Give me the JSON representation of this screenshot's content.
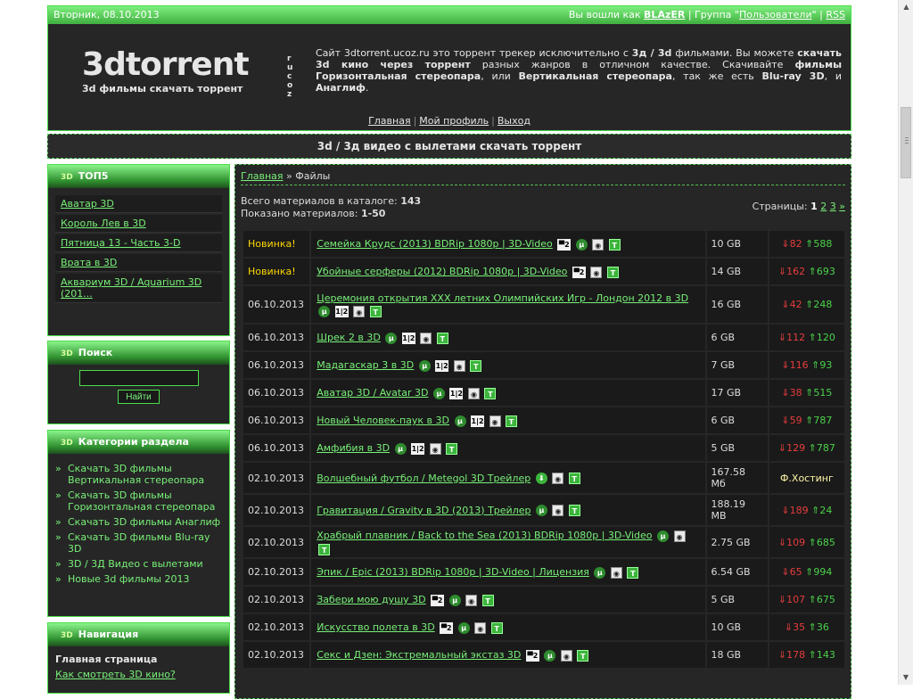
{
  "topbar": {
    "date": "Вторник, 08.10.2013",
    "logged_as": "Вы вошли как",
    "user": "BLAzER",
    "group_prefix": "| Группа \"",
    "group": "Пользователи",
    "group_suffix": "\" |",
    "rss": "RSS"
  },
  "logo": {
    "name": "3dtorrent",
    "domain": "ru\ncoz",
    "slogan": "3d фильмы скачать торрент"
  },
  "site_desc": {
    "p1": "Сайт 3dtorrent.ucoz.ru это торрент трекер исключительно с ",
    "b1": "3д / 3d",
    "p2": " фильмами. Вы можете ",
    "b2": "скачать 3d кино через торрент",
    "p3": " разных жанров в отличном качестве. Скачивайте ",
    "b3": "фильмы Горизонтальная стереопара",
    "p4": ", или ",
    "b4": "Вертикальная стереопара",
    "p5": ", так же есть ",
    "b5": "Blu-ray 3D",
    "p6": ", и ",
    "b6": "Анаглиф",
    "p7": "."
  },
  "header_nav": [
    "Главная",
    "Мой профиль",
    "Выход"
  ],
  "page_title": "3d / 3д видео с вылетами скачать торрент",
  "top5": {
    "title": "ТОП5",
    "items": [
      "Аватар 3D",
      "Король Лев в 3D",
      "Пятница 13 - Часть 3-D",
      "Врата в 3D",
      "Аквариум 3D / Aquarium 3D (201..."
    ]
  },
  "search": {
    "title": "Поиск",
    "value": "",
    "button": "Найти"
  },
  "categories": {
    "title": "Категории раздела",
    "items": [
      "Скачать 3D фильмы Вертикальная стереопара",
      "Скачать 3D фильмы Горизонтальная стереопара",
      "Скачать 3D фильмы Анаглиф",
      "Скачать 3D фильмы Blu-ray 3D",
      "3D / 3Д Видео с вылетами",
      "Новые 3d фильмы 2013"
    ]
  },
  "navigation": {
    "title": "Навигация",
    "home": "Главная страница",
    "link1": "Как смотреть 3D кино?"
  },
  "breadcrumb": {
    "home": "Главная",
    "sep": "»",
    "current": "Файлы"
  },
  "stats": {
    "total_label": "Всего материалов в каталоге:",
    "total": "143",
    "shown_label": "Показано материалов:",
    "shown": "1-50"
  },
  "pager": {
    "label": "Страницы:",
    "current": "1",
    "pages": [
      "2",
      "3",
      "»"
    ]
  },
  "files": [
    {
      "date": "Новинка!",
      "new": true,
      "title": "Семейка Крудс (2013) BDRip 1080p | 3D-Video",
      "icons": [
        "vs",
        "utor",
        "eye",
        "t"
      ],
      "size": "10 GB",
      "down": "82",
      "up": "588"
    },
    {
      "date": "Новинка!",
      "new": true,
      "title": "Убойные серферы (2012) BDRip 1080p | 3D-Video",
      "icons": [
        "vs",
        "eye",
        "t"
      ],
      "size": "14 GB",
      "down": "162",
      "up": "693"
    },
    {
      "date": "06.10.2013",
      "title": "Церемония открытия XXX летних Олимпийских Игр - Лондон 2012 в 3D",
      "icons": [
        "utor",
        "12",
        "eye",
        "t"
      ],
      "size": "16 GB",
      "down": "42",
      "up": "248"
    },
    {
      "date": "06.10.2013",
      "title": "Шрек 2 в 3D",
      "icons": [
        "utor",
        "12",
        "eye",
        "t"
      ],
      "size": "6 GB",
      "down": "112",
      "up": "120"
    },
    {
      "date": "06.10.2013",
      "title": "Мадагаскар 3 в 3D",
      "icons": [
        "utor",
        "12",
        "eye",
        "t"
      ],
      "size": "7 GB",
      "down": "116",
      "up": "93"
    },
    {
      "date": "06.10.2013",
      "title": "Аватар 3D / Avatar 3D",
      "icons": [
        "utor",
        "12",
        "eye",
        "t"
      ],
      "size": "17 GB",
      "down": "38",
      "up": "515"
    },
    {
      "date": "06.10.2013",
      "title": "Новый Человек-паук в 3D",
      "icons": [
        "utor",
        "12",
        "eye",
        "t"
      ],
      "size": "6 GB",
      "down": "59",
      "up": "787"
    },
    {
      "date": "06.10.2013",
      "title": "Амфибия в 3D",
      "icons": [
        "utor",
        "12",
        "eye",
        "t"
      ],
      "size": "5 GB",
      "down": "129",
      "up": "787"
    },
    {
      "date": "02.10.2013",
      "title": "Волшебный футбол / Metegol 3D Трейлер",
      "icons": [
        "down",
        "eye",
        "t"
      ],
      "size": "167.58 Мб",
      "host": "Ф.Хостинг"
    },
    {
      "date": "02.10.2013",
      "title": "Гравитация / Gravity в 3D (2013) Трейлер",
      "icons": [
        "utor",
        "eye",
        "t"
      ],
      "size": "188.19 MB",
      "down": "189",
      "up": "24"
    },
    {
      "date": "02.10.2013",
      "title": "Храбрый плавник / Back to the Sea (2013) BDRip 1080p | 3D-Video",
      "icons": [
        "utor",
        "eye",
        "t"
      ],
      "size": "2.75 GB",
      "down": "109",
      "up": "685"
    },
    {
      "date": "02.10.2013",
      "title": "Эпик / Epic (2013) BDRip 1080p | 3D-Video | Лицензия",
      "icons": [
        "utor",
        "eye",
        "t"
      ],
      "size": "6.54 GB",
      "down": "65",
      "up": "994"
    },
    {
      "date": "02.10.2013",
      "title": "Забери мою душу 3D",
      "icons": [
        "vs",
        "utor",
        "eye",
        "t"
      ],
      "size": "5 GB",
      "down": "107",
      "up": "675"
    },
    {
      "date": "02.10.2013",
      "title": "Искусство полета в 3D",
      "icons": [
        "vs",
        "utor",
        "eye",
        "t"
      ],
      "size": "10 GB",
      "down": "35",
      "up": "36"
    },
    {
      "date": "02.10.2013",
      "title": "Секс и Дзен: Экстремальный экстаз 3D",
      "icons": [
        "vs",
        "utor",
        "eye",
        "t"
      ],
      "size": "18 GB",
      "down": "178",
      "up": "143"
    }
  ],
  "icon_glyphs": {
    "utor": "µ",
    "eye": "◉",
    "t": "T",
    "12": "1|2",
    "vs": "▀2",
    "down": "⬇"
  },
  "colors": {
    "accent": "#4ade4a",
    "link": "#78f078",
    "bg": "#262626",
    "down": "#e63c3c",
    "up": "#4ad24a",
    "new": "#ffd700"
  }
}
